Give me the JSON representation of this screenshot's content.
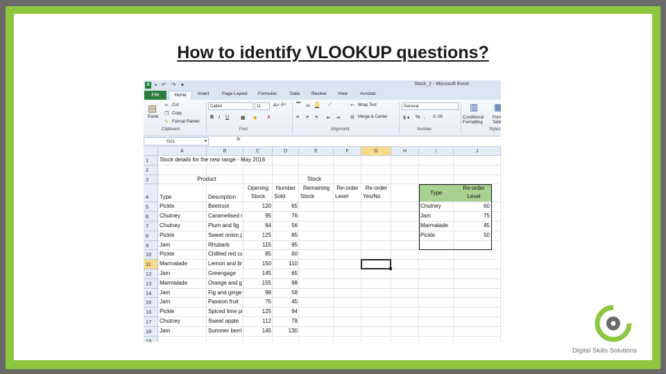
{
  "slide": {
    "title": "How to identify VLOOKUP questions?"
  },
  "window": {
    "title": "Stock_2 - Microsoft Excel",
    "tabs": [
      "File",
      "Home",
      "Insert",
      "Page Layout",
      "Formulas",
      "Data",
      "Review",
      "View",
      "Acrobat"
    ],
    "ribbon": {
      "paste_label": "Paste",
      "cut_label": "Cut",
      "copy_label": "Copy",
      "format_painter_label": "Format Painter",
      "clipboard_group": "Clipboard",
      "font_name": "Calibri",
      "font_size": "11",
      "font_group": "Font",
      "wrap_text_label": "Wrap Text",
      "merge_label": "Merge & Center",
      "alignment_group": "Alignment",
      "number_format": "General",
      "number_group": "Number",
      "conditional_label": "Conditional Formatting",
      "format_table_label": "Format as Table",
      "styles_group": "Styles"
    },
    "name_box": "G11",
    "fx": "fx"
  },
  "sheet": {
    "columns": [
      "A",
      "B",
      "C",
      "D",
      "E",
      "F",
      "G",
      "H",
      "I",
      "J"
    ],
    "active_column": "G",
    "active_row": 11,
    "row_numbers": [
      "1",
      "2",
      "3",
      "4",
      "5",
      "6",
      "7",
      "8",
      "9",
      "10",
      "11",
      "12",
      "13",
      "14",
      "15",
      "16",
      "17",
      "18",
      "19"
    ],
    "a1": "Stock details for the new range - May 2016",
    "header_row3": {
      "product": "Product",
      "stock": "Stock"
    },
    "header_row4": {
      "type": "Type",
      "description": "Description",
      "opening_1": "Opening",
      "opening_2": "Stock",
      "number_1": "Number",
      "number_2": "Sold",
      "remaining_1": "Remaining",
      "remaining_2": "Stock",
      "reorder_level_1": "Re-order",
      "reorder_level_2": "Level",
      "reorder_yn_1": "Re-order",
      "reorder_yn_2": "Yes/No"
    },
    "rows": [
      {
        "type": "Pickle",
        "description": "Beetroot",
        "opening": "120",
        "sold": "65"
      },
      {
        "type": "Chutney",
        "description": "Caramelised red",
        "opening": "95",
        "sold": "76"
      },
      {
        "type": "Chutney",
        "description": "Plum and fig",
        "opening": "84",
        "sold": "56"
      },
      {
        "type": "Pickle",
        "description": "Sweet onion pic",
        "opening": "125",
        "sold": "85"
      },
      {
        "type": "Jam",
        "description": "Rhubarb",
        "opening": "115",
        "sold": "95"
      },
      {
        "type": "Pickle",
        "description": "Chillied red cabb",
        "opening": "85",
        "sold": "60"
      },
      {
        "type": "Marmalade",
        "description": "Lemon and lime",
        "opening": "150",
        "sold": "110"
      },
      {
        "type": "Jam",
        "description": "Greengage",
        "opening": "145",
        "sold": "65"
      },
      {
        "type": "Marmalade",
        "description": "Orange and ging",
        "opening": "155",
        "sold": "98"
      },
      {
        "type": "Jam",
        "description": "Fig and ginger",
        "opening": "98",
        "sold": "58"
      },
      {
        "type": "Jam",
        "description": "Passion fruit",
        "opening": "75",
        "sold": "45"
      },
      {
        "type": "Pickle",
        "description": "Spiced lime pickl",
        "opening": "125",
        "sold": "94"
      },
      {
        "type": "Chutney",
        "description": "Sweet apple",
        "opening": "112",
        "sold": "79"
      },
      {
        "type": "Jam",
        "description": "Summer berries",
        "opening": "145",
        "sold": "130"
      }
    ],
    "lookup_table": {
      "header_type": "Type",
      "header_level_1": "Re-order",
      "header_level_2": "Level",
      "rows": [
        {
          "type": "Chutney",
          "level": "60"
        },
        {
          "type": "Jam",
          "level": "75"
        },
        {
          "type": "Marmalade",
          "level": "45"
        },
        {
          "type": "Pickle",
          "level": "50"
        }
      ]
    }
  },
  "branding": {
    "company": "Digital Skills Solutions",
    "accent": "#8dc63f"
  }
}
